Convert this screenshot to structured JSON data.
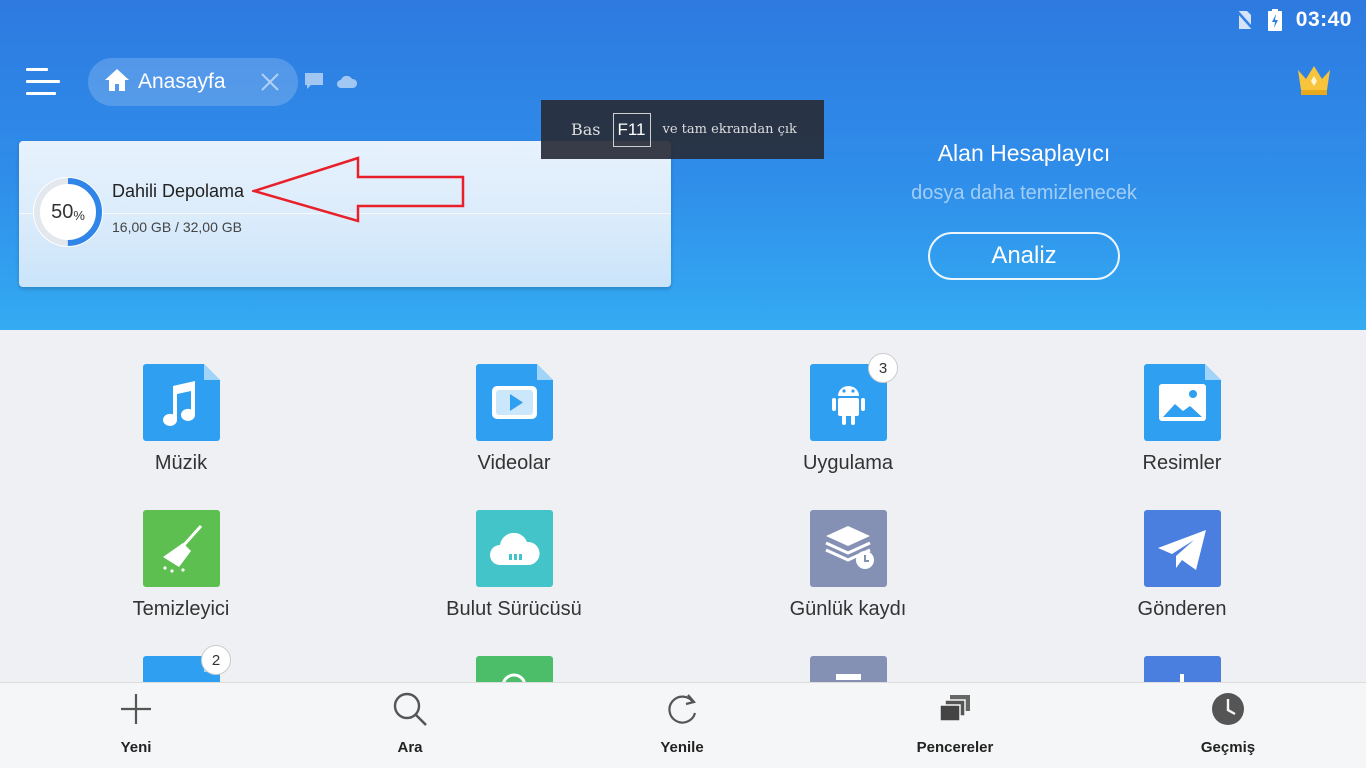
{
  "status_bar": {
    "time": "03:40",
    "icons": [
      "no-sim-icon",
      "battery-charging-icon"
    ]
  },
  "header": {
    "menu_icon": "hamburger-menu-icon",
    "tab": {
      "icon": "home-icon",
      "label": "Anasayfa",
      "close_icon": "close-icon"
    },
    "extra_icons": [
      "chat-bubble-icon",
      "cloud-icon"
    ],
    "premium_icon": "crown-icon"
  },
  "fullscreen_hint": {
    "prefix": "Bas",
    "key": "F11",
    "suffix": "ve tam ekrandan çık"
  },
  "storage": {
    "name": "Dahili Depolama",
    "percent": "50",
    "percent_sign": "%",
    "usage": "16,00 GB / 32,00 GB",
    "used_fraction": 0.5
  },
  "analyzer": {
    "title": "Alan Hesaplayıcı",
    "subtitle": "dosya daha temizlenecek",
    "button": "Analiz"
  },
  "categories": [
    {
      "label": "Müzik",
      "icon": "music-note-icon",
      "color": "#2f9ff1",
      "badge": ""
    },
    {
      "label": "Videolar",
      "icon": "video-play-icon",
      "color": "#2f9ff1",
      "badge": ""
    },
    {
      "label": "Uygulama",
      "icon": "android-icon",
      "color": "#2f9ff1",
      "badge": "3"
    },
    {
      "label": "Resimler",
      "icon": "image-icon",
      "color": "#2f9ff1",
      "badge": ""
    },
    {
      "label": "Temizleyici",
      "icon": "broom-icon",
      "color": "#5cbf50",
      "badge": ""
    },
    {
      "label": "Bulut Sürücüsü",
      "icon": "cloud-drive-icon",
      "color": "#42c4c8",
      "badge": ""
    },
    {
      "label": "Günlük kaydı",
      "icon": "log-layers-icon",
      "color": "#8590b5",
      "badge": ""
    },
    {
      "label": "Gönderen",
      "icon": "paper-plane-icon",
      "color": "#4a7fe0",
      "badge": ""
    },
    {
      "label": "",
      "icon": "document-icon",
      "color": "#2f9ff1",
      "badge": "2"
    },
    {
      "label": "",
      "icon": "chat-icon",
      "color": "#4cbe6a",
      "badge": ""
    },
    {
      "label": "",
      "icon": "printer-icon",
      "color": "#8590b5",
      "badge": ""
    },
    {
      "label": "",
      "icon": "add-icon",
      "color": "#4a7fe0",
      "badge": ""
    }
  ],
  "bottom_nav": [
    {
      "label": "Yeni",
      "icon": "plus-icon"
    },
    {
      "label": "Ara",
      "icon": "search-icon"
    },
    {
      "label": "Yenile",
      "icon": "refresh-icon"
    },
    {
      "label": "Pencereler",
      "icon": "windows-stack-icon"
    },
    {
      "label": "Geçmiş",
      "icon": "clock-icon"
    }
  ]
}
